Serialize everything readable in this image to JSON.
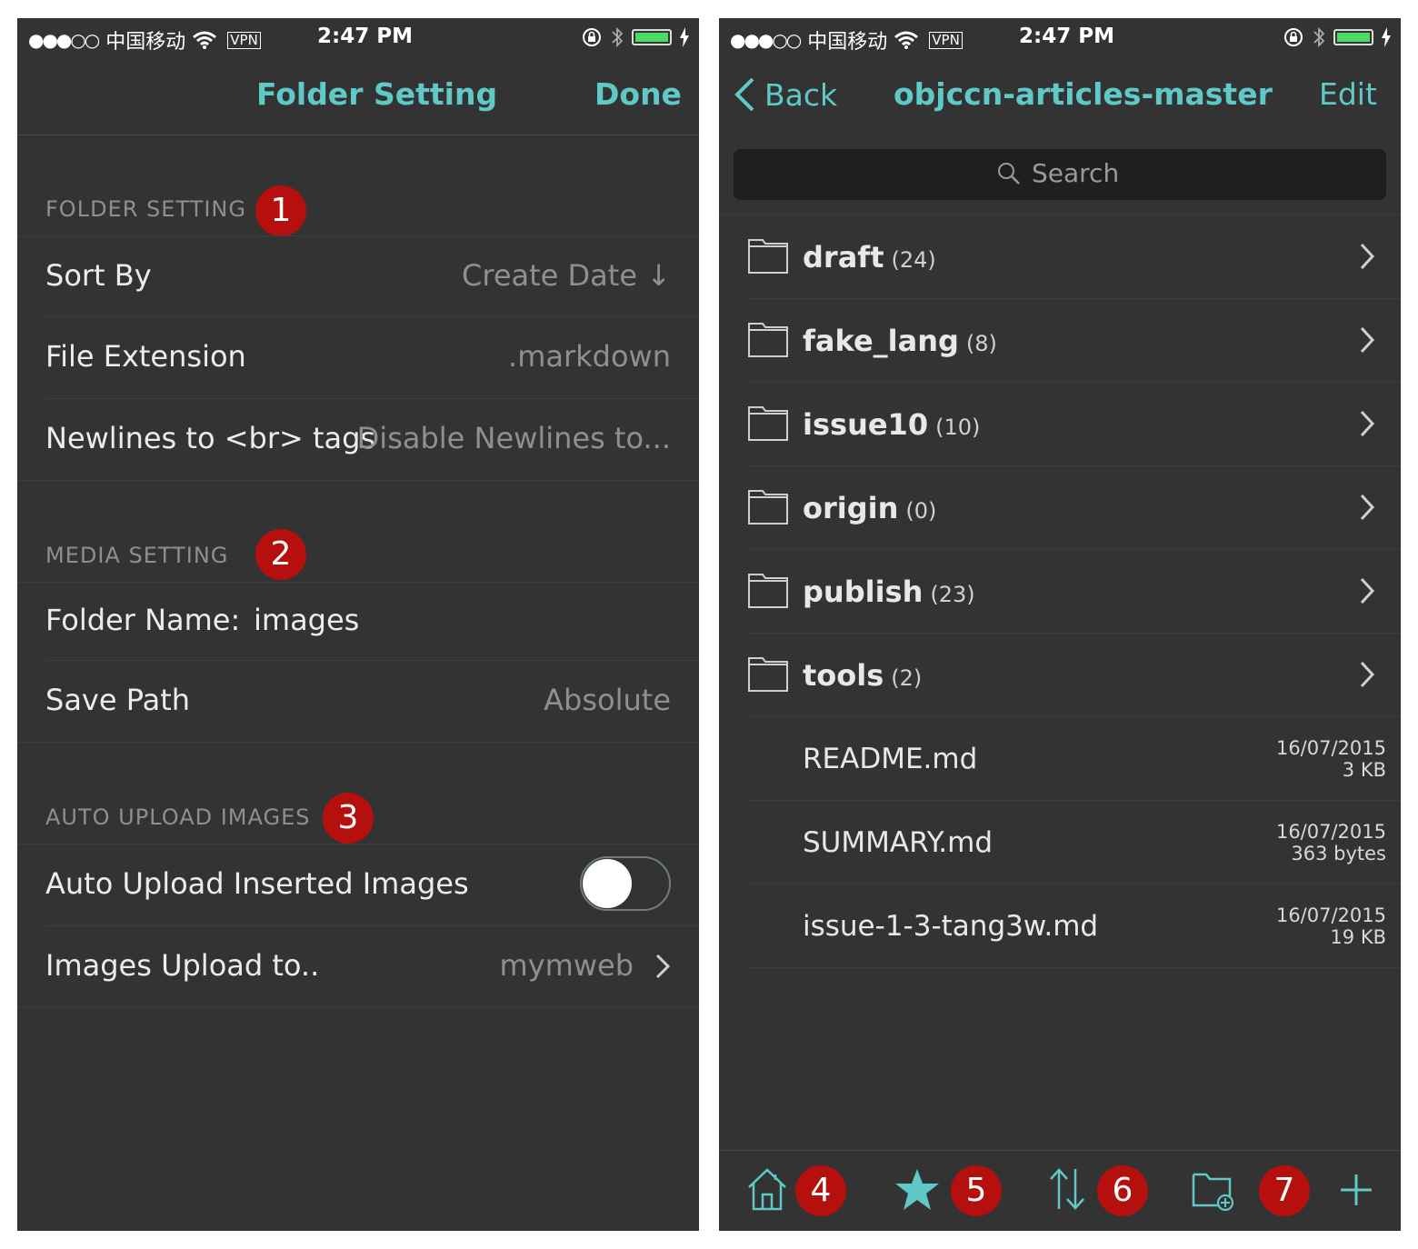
{
  "colors": {
    "accent": "#5ec9c6",
    "background": "#333333",
    "badge": "#b5100d",
    "battery": "#4cd964"
  },
  "status_bar": {
    "carrier": "中国移动",
    "signal": "●●●○○",
    "vpn": "VPN",
    "time": "2:47 PM"
  },
  "left": {
    "nav": {
      "title": "Folder Setting",
      "done": "Done"
    },
    "sections": {
      "folder": {
        "header": "FOLDER SETTING",
        "badge": "1"
      },
      "media": {
        "header": "MEDIA SETTING",
        "badge": "2"
      },
      "upload": {
        "header": "AUTO UPLOAD IMAGES",
        "badge": "3"
      }
    },
    "cells": {
      "sort_by": {
        "label": "Sort By",
        "value": "Create Date ↓"
      },
      "file_extension": {
        "label": "File Extension",
        "value": ".markdown"
      },
      "newlines": {
        "label": "Newlines to <br> tags",
        "value": "Disable Newlines to..."
      },
      "folder_name": {
        "label": "Folder Name:",
        "value": "images"
      },
      "save_path": {
        "label": "Save Path",
        "value": "Absolute"
      },
      "auto_upload": {
        "label": "Auto Upload Inserted Images",
        "enabled": false
      },
      "upload_to": {
        "label": "Images Upload to..",
        "value": "mymweb"
      }
    }
  },
  "right": {
    "nav": {
      "back": "Back",
      "title": "objccn-articles-master",
      "edit": "Edit"
    },
    "search_placeholder": "Search",
    "folders": [
      {
        "name": "draft",
        "count": "(24)"
      },
      {
        "name": "fake_lang",
        "count": "(8)"
      },
      {
        "name": "issue10",
        "count": "(10)"
      },
      {
        "name": "origin",
        "count": "(0)"
      },
      {
        "name": "publish",
        "count": "(23)"
      },
      {
        "name": "tools",
        "count": "(2)"
      }
    ],
    "files": [
      {
        "name": "README.md",
        "date": "16/07/2015",
        "size": "3 KB"
      },
      {
        "name": "SUMMARY.md",
        "date": "16/07/2015",
        "size": "363 bytes"
      },
      {
        "name": "issue-1-3-tang3w.md",
        "date": "16/07/2015",
        "size": "19 KB"
      }
    ],
    "toolbar_badges": {
      "home": "4",
      "star": "5",
      "sort": "6",
      "new_folder": "7"
    },
    "toolbar_icons": [
      "home-icon",
      "star-icon",
      "sort-icon",
      "new-folder-icon",
      "plus-icon"
    ]
  }
}
